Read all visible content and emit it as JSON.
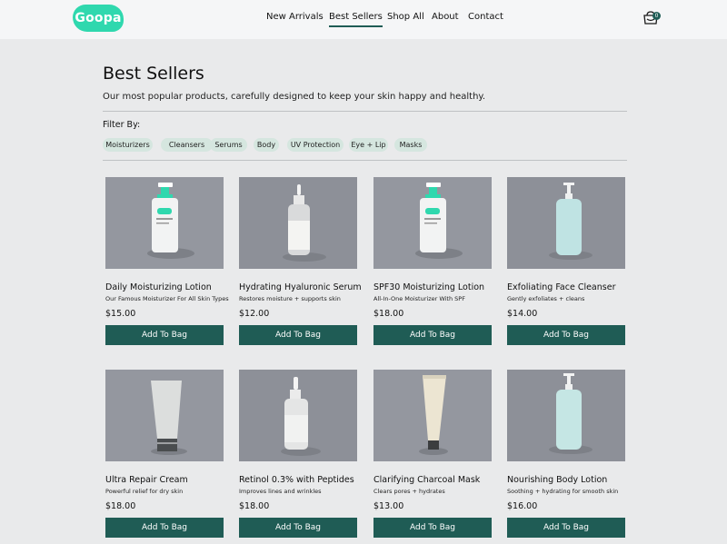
{
  "brand": {
    "logo_text": "Goopa",
    "accent": "#2fd8ae",
    "primary": "#1f5c55"
  },
  "nav": {
    "items": [
      {
        "label": "New Arrivals",
        "active": false
      },
      {
        "label": "Best Sellers",
        "active": true
      },
      {
        "label": "Shop All",
        "active": false
      },
      {
        "label": "About",
        "active": false
      },
      {
        "label": "Contact",
        "active": false
      }
    ],
    "cart_icon": "shopping-bag-icon",
    "cart_count": "0"
  },
  "page": {
    "title": "Best Sellers",
    "subtitle": "Our most popular products, carefully designed to keep your skin happy and healthy."
  },
  "filters": {
    "label": "Filter By:",
    "chips": [
      "Moisturizers",
      "Cleansers",
      "Serums",
      "Body",
      "UV Protection",
      "Eye + Lip",
      "Masks"
    ]
  },
  "products": [
    {
      "name": "Daily Moisturizing Lotion",
      "desc": "Our Famous Moisturizer For All Skin Types",
      "price": "$15.00",
      "button": "Add To Bag",
      "image": "pump-bottle-green-image"
    },
    {
      "name": "Hydrating Hyaluronic Serum",
      "desc": "Restores moisture + supports skin",
      "price": "$12.00",
      "button": "Add To Bag",
      "image": "dropper-bottle-image"
    },
    {
      "name": "SPF30 Moisturizing Lotion",
      "desc": "All-In-One Moisturizer With SPF",
      "price": "$18.00",
      "button": "Add To Bag",
      "image": "pump-bottle-green-image"
    },
    {
      "name": "Exfoliating Face Cleanser",
      "desc": "Gently exfoliates + cleans",
      "price": "$14.00",
      "button": "Add To Bag",
      "image": "pump-bottle-blue-image"
    },
    {
      "name": "Ultra Repair Cream",
      "desc": "Powerful relief for dry skin",
      "price": "$18.00",
      "button": "Add To Bag",
      "image": "tube-image"
    },
    {
      "name": "Retinol 0.3% with Peptides",
      "desc": "Improves lines and wrinkles",
      "price": "$18.00",
      "button": "Add To Bag",
      "image": "dropper-bottle-clear-image"
    },
    {
      "name": "Clarifying Charcoal Mask",
      "desc": "Clears pores + hydrates",
      "price": "$13.00",
      "button": "Add To Bag",
      "image": "tube-cream-image"
    },
    {
      "name": "Nourishing Body Lotion",
      "desc": "Soothing + hydrating for smooth skin",
      "price": "$16.00",
      "button": "Add To Bag",
      "image": "pump-bottle-blue-image"
    }
  ]
}
